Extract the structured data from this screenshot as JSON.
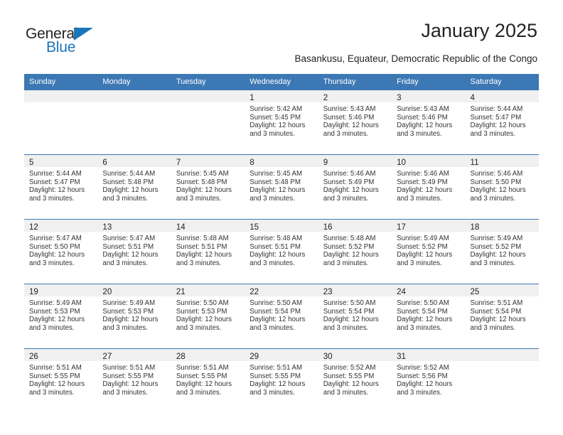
{
  "brand": {
    "name_part1": "General",
    "name_part2": "Blue",
    "accent_color": "#1b75bb"
  },
  "header": {
    "title": "January 2025",
    "subtitle": "Basankusu, Equateur, Democratic Republic of the Congo"
  },
  "calendar": {
    "header_color": "#3c78b4",
    "band_color": "#f0f0f0",
    "weekdays": [
      "Sunday",
      "Monday",
      "Tuesday",
      "Wednesday",
      "Thursday",
      "Friday",
      "Saturday"
    ],
    "weeks": [
      [
        {
          "day": ""
        },
        {
          "day": ""
        },
        {
          "day": ""
        },
        {
          "day": "1",
          "sunrise": "Sunrise: 5:42 AM",
          "sunset": "Sunset: 5:45 PM",
          "daylight1": "Daylight: 12 hours",
          "daylight2": "and 3 minutes."
        },
        {
          "day": "2",
          "sunrise": "Sunrise: 5:43 AM",
          "sunset": "Sunset: 5:46 PM",
          "daylight1": "Daylight: 12 hours",
          "daylight2": "and 3 minutes."
        },
        {
          "day": "3",
          "sunrise": "Sunrise: 5:43 AM",
          "sunset": "Sunset: 5:46 PM",
          "daylight1": "Daylight: 12 hours",
          "daylight2": "and 3 minutes."
        },
        {
          "day": "4",
          "sunrise": "Sunrise: 5:44 AM",
          "sunset": "Sunset: 5:47 PM",
          "daylight1": "Daylight: 12 hours",
          "daylight2": "and 3 minutes."
        }
      ],
      [
        {
          "day": "5",
          "sunrise": "Sunrise: 5:44 AM",
          "sunset": "Sunset: 5:47 PM",
          "daylight1": "Daylight: 12 hours",
          "daylight2": "and 3 minutes."
        },
        {
          "day": "6",
          "sunrise": "Sunrise: 5:44 AM",
          "sunset": "Sunset: 5:48 PM",
          "daylight1": "Daylight: 12 hours",
          "daylight2": "and 3 minutes."
        },
        {
          "day": "7",
          "sunrise": "Sunrise: 5:45 AM",
          "sunset": "Sunset: 5:48 PM",
          "daylight1": "Daylight: 12 hours",
          "daylight2": "and 3 minutes."
        },
        {
          "day": "8",
          "sunrise": "Sunrise: 5:45 AM",
          "sunset": "Sunset: 5:48 PM",
          "daylight1": "Daylight: 12 hours",
          "daylight2": "and 3 minutes."
        },
        {
          "day": "9",
          "sunrise": "Sunrise: 5:46 AM",
          "sunset": "Sunset: 5:49 PM",
          "daylight1": "Daylight: 12 hours",
          "daylight2": "and 3 minutes."
        },
        {
          "day": "10",
          "sunrise": "Sunrise: 5:46 AM",
          "sunset": "Sunset: 5:49 PM",
          "daylight1": "Daylight: 12 hours",
          "daylight2": "and 3 minutes."
        },
        {
          "day": "11",
          "sunrise": "Sunrise: 5:46 AM",
          "sunset": "Sunset: 5:50 PM",
          "daylight1": "Daylight: 12 hours",
          "daylight2": "and 3 minutes."
        }
      ],
      [
        {
          "day": "12",
          "sunrise": "Sunrise: 5:47 AM",
          "sunset": "Sunset: 5:50 PM",
          "daylight1": "Daylight: 12 hours",
          "daylight2": "and 3 minutes."
        },
        {
          "day": "13",
          "sunrise": "Sunrise: 5:47 AM",
          "sunset": "Sunset: 5:51 PM",
          "daylight1": "Daylight: 12 hours",
          "daylight2": "and 3 minutes."
        },
        {
          "day": "14",
          "sunrise": "Sunrise: 5:48 AM",
          "sunset": "Sunset: 5:51 PM",
          "daylight1": "Daylight: 12 hours",
          "daylight2": "and 3 minutes."
        },
        {
          "day": "15",
          "sunrise": "Sunrise: 5:48 AM",
          "sunset": "Sunset: 5:51 PM",
          "daylight1": "Daylight: 12 hours",
          "daylight2": "and 3 minutes."
        },
        {
          "day": "16",
          "sunrise": "Sunrise: 5:48 AM",
          "sunset": "Sunset: 5:52 PM",
          "daylight1": "Daylight: 12 hours",
          "daylight2": "and 3 minutes."
        },
        {
          "day": "17",
          "sunrise": "Sunrise: 5:49 AM",
          "sunset": "Sunset: 5:52 PM",
          "daylight1": "Daylight: 12 hours",
          "daylight2": "and 3 minutes."
        },
        {
          "day": "18",
          "sunrise": "Sunrise: 5:49 AM",
          "sunset": "Sunset: 5:52 PM",
          "daylight1": "Daylight: 12 hours",
          "daylight2": "and 3 minutes."
        }
      ],
      [
        {
          "day": "19",
          "sunrise": "Sunrise: 5:49 AM",
          "sunset": "Sunset: 5:53 PM",
          "daylight1": "Daylight: 12 hours",
          "daylight2": "and 3 minutes."
        },
        {
          "day": "20",
          "sunrise": "Sunrise: 5:49 AM",
          "sunset": "Sunset: 5:53 PM",
          "daylight1": "Daylight: 12 hours",
          "daylight2": "and 3 minutes."
        },
        {
          "day": "21",
          "sunrise": "Sunrise: 5:50 AM",
          "sunset": "Sunset: 5:53 PM",
          "daylight1": "Daylight: 12 hours",
          "daylight2": "and 3 minutes."
        },
        {
          "day": "22",
          "sunrise": "Sunrise: 5:50 AM",
          "sunset": "Sunset: 5:54 PM",
          "daylight1": "Daylight: 12 hours",
          "daylight2": "and 3 minutes."
        },
        {
          "day": "23",
          "sunrise": "Sunrise: 5:50 AM",
          "sunset": "Sunset: 5:54 PM",
          "daylight1": "Daylight: 12 hours",
          "daylight2": "and 3 minutes."
        },
        {
          "day": "24",
          "sunrise": "Sunrise: 5:50 AM",
          "sunset": "Sunset: 5:54 PM",
          "daylight1": "Daylight: 12 hours",
          "daylight2": "and 3 minutes."
        },
        {
          "day": "25",
          "sunrise": "Sunrise: 5:51 AM",
          "sunset": "Sunset: 5:54 PM",
          "daylight1": "Daylight: 12 hours",
          "daylight2": "and 3 minutes."
        }
      ],
      [
        {
          "day": "26",
          "sunrise": "Sunrise: 5:51 AM",
          "sunset": "Sunset: 5:55 PM",
          "daylight1": "Daylight: 12 hours",
          "daylight2": "and 3 minutes."
        },
        {
          "day": "27",
          "sunrise": "Sunrise: 5:51 AM",
          "sunset": "Sunset: 5:55 PM",
          "daylight1": "Daylight: 12 hours",
          "daylight2": "and 3 minutes."
        },
        {
          "day": "28",
          "sunrise": "Sunrise: 5:51 AM",
          "sunset": "Sunset: 5:55 PM",
          "daylight1": "Daylight: 12 hours",
          "daylight2": "and 3 minutes."
        },
        {
          "day": "29",
          "sunrise": "Sunrise: 5:51 AM",
          "sunset": "Sunset: 5:55 PM",
          "daylight1": "Daylight: 12 hours",
          "daylight2": "and 3 minutes."
        },
        {
          "day": "30",
          "sunrise": "Sunrise: 5:52 AM",
          "sunset": "Sunset: 5:55 PM",
          "daylight1": "Daylight: 12 hours",
          "daylight2": "and 3 minutes."
        },
        {
          "day": "31",
          "sunrise": "Sunrise: 5:52 AM",
          "sunset": "Sunset: 5:56 PM",
          "daylight1": "Daylight: 12 hours",
          "daylight2": "and 3 minutes."
        },
        {
          "day": ""
        }
      ]
    ]
  }
}
